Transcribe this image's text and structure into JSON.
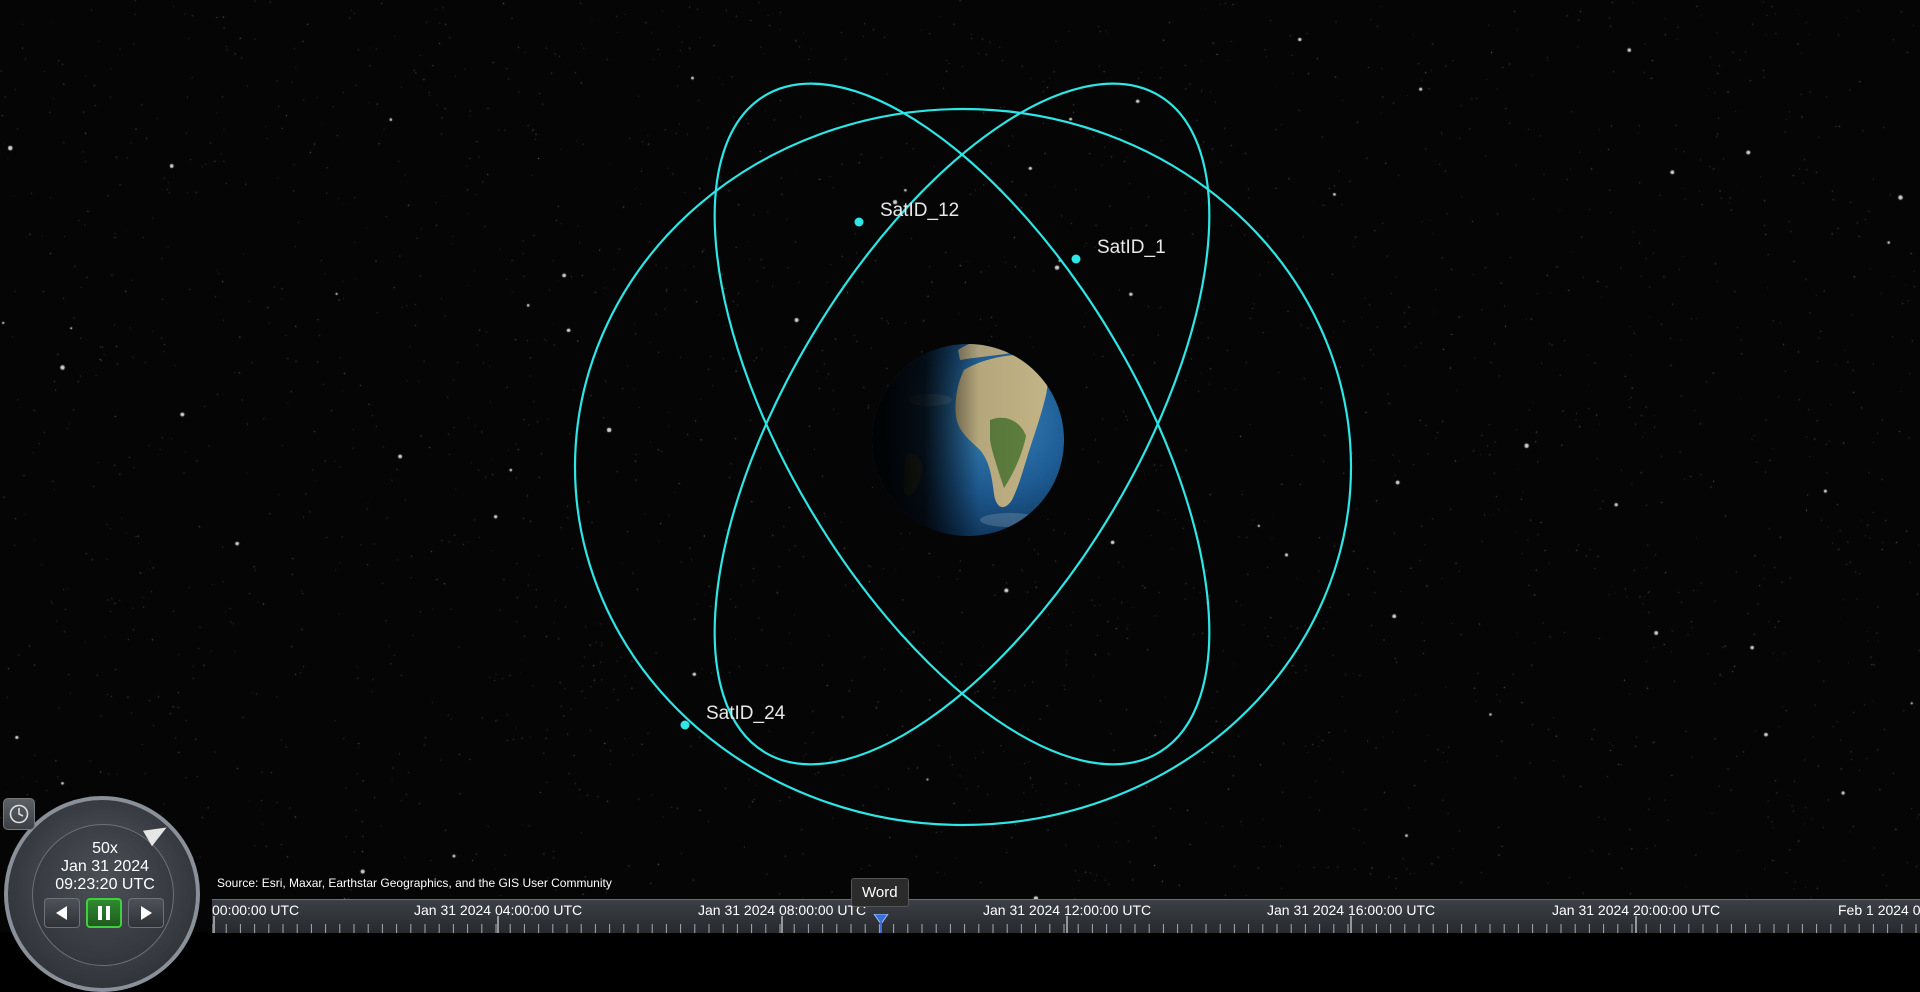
{
  "scene": {
    "satellites": [
      {
        "label": "SatID_12"
      },
      {
        "label": "SatID_1"
      },
      {
        "label": "SatID_24"
      }
    ],
    "orbit_color": "#2ee6e6",
    "globe_icon": "earth-globe"
  },
  "animation": {
    "speed": "50x",
    "date": "Jan 31 2024",
    "time": "09:23:20 UTC",
    "icons": {
      "clock": "clock-icon",
      "reverse": "play-reverse-icon",
      "pause": "pause-icon",
      "play": "play-icon"
    }
  },
  "credit": "Source: Esri, Maxar, Earthstar Geographics, and the GIS User Community",
  "timeline": {
    "labels": [
      "00:00:00 UTC",
      "Jan 31 2024 04:00:00 UTC",
      "Jan 31 2024 08:00:00 UTC",
      "Jan 31 2024 12:00:00 UTC",
      "Jan 31 2024 16:00:00 UTC",
      "Jan 31 2024 20:00:00 UTC",
      "Feb 1 2024 0"
    ]
  },
  "tooltip": "Word"
}
